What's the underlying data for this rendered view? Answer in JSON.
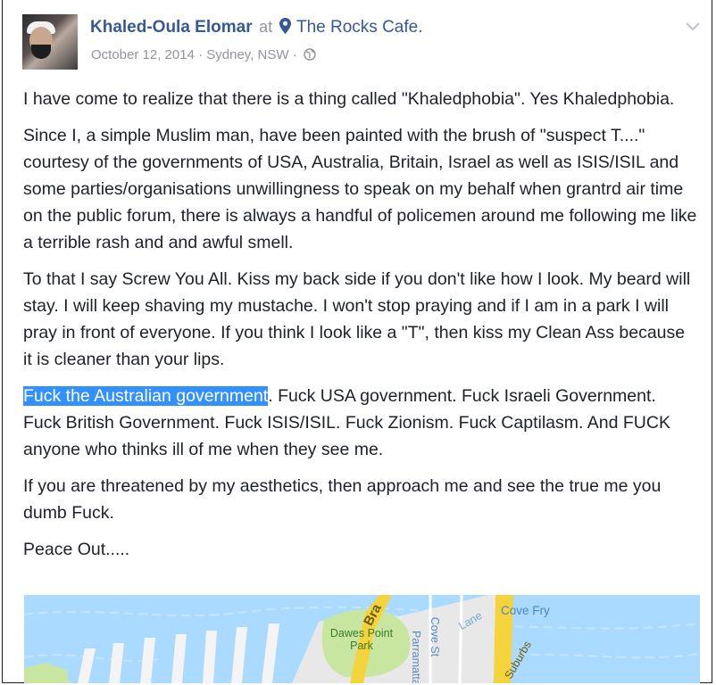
{
  "post": {
    "author": "Khaled-Oula Elomar",
    "at_word": "at",
    "location": "The Rocks Cafe.",
    "date": "October 12, 2014",
    "city": "Sydney, NSW",
    "separator": "·",
    "paragraphs": [
      "I have come to realize that there is a thing called \"Khaledphobia\". Yes Khaledphobia.",
      "Since I, a simple Muslim man, have been painted with the brush of \"suspect T....\" courtesy of the governments of USA, Australia, Britain, Israel as well as ISIS/ISIL and some parties/organisations unwillingness to speak on my behalf when grantrd air time on the public forum, there is always a handful of policemen around me following me like a terrible rash and and awful smell.",
      "To that I say Screw You All. Kiss my back side if you don't like how I look. My beard will stay. I will keep shaving my mustache. I won't stop praying and if I am in a park I will pray in front of everyone. If you think I look like a \"T\", then kiss my Clean Ass because it is cleaner than your lips.",
      {
        "highlighted": "Fuck the Australian government",
        "rest": ". Fuck USA government. Fuck Israeli Government. Fuck British Government. Fuck ISIS/ISIL. Fuck Zionism. Fuck Captilasm. And FUCK anyone who thinks ill of me when they see me."
      },
      "If you are threatened by my aesthetics, then approach me and see the true me you dumb Fuck.",
      "Peace Out....."
    ]
  },
  "map": {
    "labels": {
      "park_line1": "Dawes Point",
      "park_line2": "Park",
      "bradfield": "Bra",
      "cove_st": "Cove St",
      "parramatta": "Parramatta R",
      "lane": "Lane",
      "cove_fry": "Cove Fry",
      "suburbs": "Suburbs"
    }
  },
  "colors": {
    "link": "#365899",
    "meta": "#90949c",
    "text": "#1d2129",
    "highlight": "#3390ff",
    "water": "#aadaff",
    "land": "#e8e8e8",
    "park": "#c8e6a0",
    "road": "#f5d33c"
  },
  "icons": [
    "location-pin-icon",
    "globe-icon",
    "chevron-down-icon"
  ]
}
